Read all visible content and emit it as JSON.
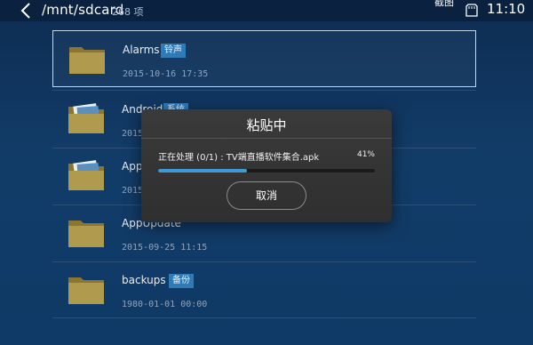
{
  "topbar": {
    "path": "/mnt/sdcard",
    "item_count": "268 项",
    "partial_label": "截图",
    "time": "11:10",
    "back_icon": "chevron-left-icon",
    "storage_icon": "sd-card-icon"
  },
  "files": [
    {
      "name": "Alarms",
      "badge": "铃声",
      "date": "2015-10-16 17:35",
      "selected": true,
      "folder_style": "plain"
    },
    {
      "name": "Android",
      "badge": "系统",
      "date": "2015-09-25 11:15",
      "selected": false,
      "folder_style": "with-papers"
    },
    {
      "name": "AppCache",
      "badge": "",
      "date": "2015-09-25 11:15",
      "selected": false,
      "folder_style": "with-papers"
    },
    {
      "name": "AppUpdate",
      "badge": "",
      "date": "2015-09-25 11:15",
      "selected": false,
      "folder_style": "plain"
    },
    {
      "name": "backups",
      "badge": "备份",
      "date": "1980-01-01 00:00",
      "selected": false,
      "folder_style": "plain"
    }
  ],
  "dialog": {
    "title": "粘贴中",
    "status": "正在处理 (0/1) : TV端直播软件集合.apk",
    "percent_label": "41%",
    "progress": 0.41,
    "cancel_label": "取消"
  },
  "colors": {
    "background": "#0f3966",
    "accent": "#3d9ad6",
    "badge": "#2f7bb8",
    "dialog": "#333333"
  }
}
